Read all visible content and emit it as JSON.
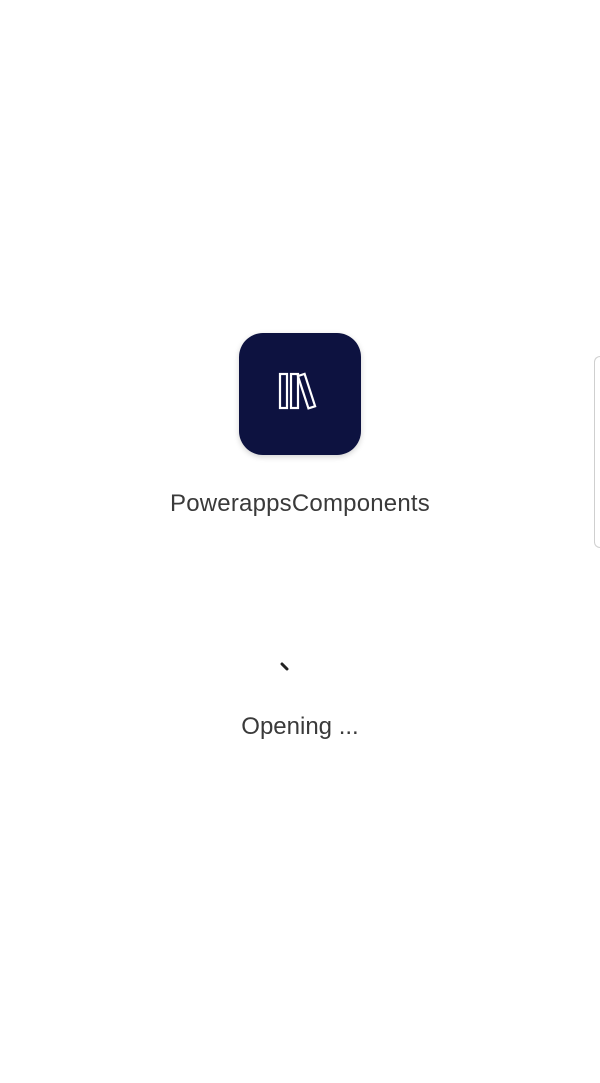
{
  "app": {
    "name": "PowerappsComponents",
    "icon": "books-icon",
    "tile_color": "#0d1240"
  },
  "loading": {
    "status": "Opening ...",
    "spinner_icon": "loading-spinner-icon"
  }
}
